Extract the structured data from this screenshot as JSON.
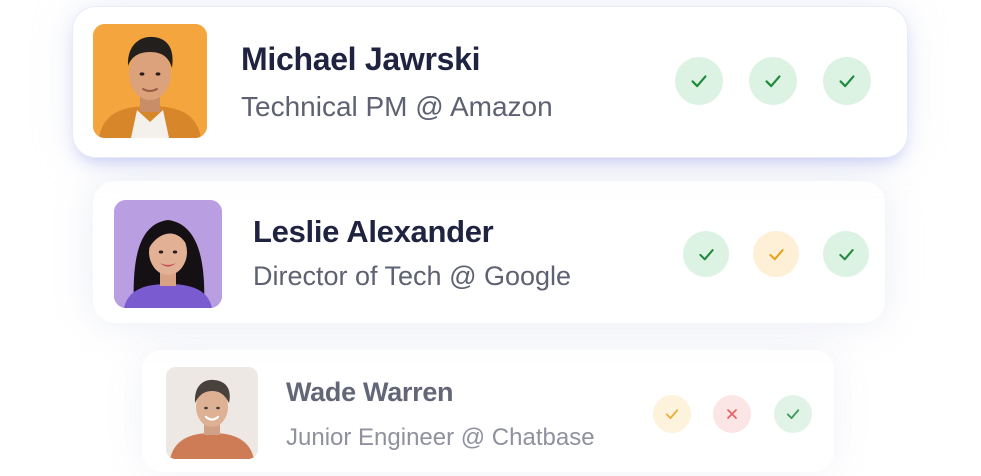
{
  "candidates": [
    {
      "name": "Michael Jawrski",
      "role": "Technical PM @ Amazon",
      "avatar_icon": "person-photo-icon",
      "checks": [
        "pass",
        "pass",
        "pass"
      ]
    },
    {
      "name": "Leslie Alexander",
      "role": "Director of Tech @ Google",
      "avatar_icon": "person-photo-icon",
      "checks": [
        "pass",
        "partial",
        "pass"
      ]
    },
    {
      "name": "Wade Warren",
      "role": "Junior Engineer @ Chatbase",
      "avatar_icon": "person-photo-icon",
      "checks": [
        "partial",
        "fail",
        "pass"
      ]
    }
  ],
  "status_colors": {
    "pass": "#1f8a3b",
    "pass_bg": "#dcf2e3",
    "partial": "#e8a21c",
    "partial_bg": "#fdf0d6",
    "fail": "#e5484d",
    "fail_bg": "#fbe1e1"
  },
  "status_icons": {
    "pass": "check-icon",
    "partial": "check-icon",
    "fail": "x-icon"
  }
}
